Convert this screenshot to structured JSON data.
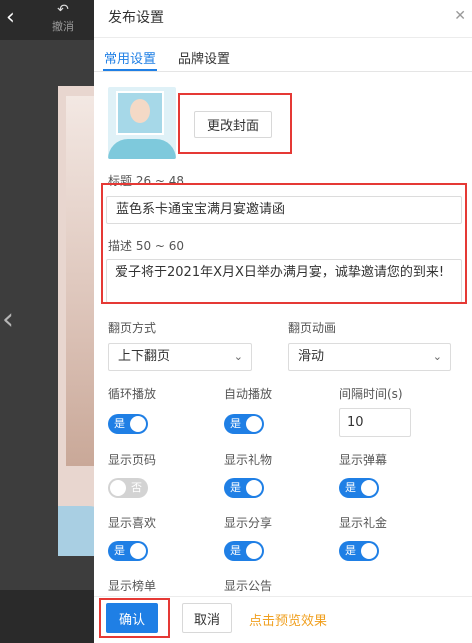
{
  "editor": {
    "undo_label": "撤消"
  },
  "panel": {
    "title": "发布设置",
    "tabs": [
      "常用设置",
      "品牌设置"
    ]
  },
  "cover": {
    "change_label": "更改封面"
  },
  "title_field": {
    "label": "标题 26 ~ 48",
    "value": "蓝色系卡通宝宝满月宴邀请函"
  },
  "desc_field": {
    "label": "描述 50 ~ 60",
    "value": "爱子将于2021年X月X日举办满月宴，诚挚邀请您的到来!"
  },
  "page_turn": {
    "label": "翻页方式",
    "value": "上下翻页"
  },
  "page_anim": {
    "label": "翻页动画",
    "value": "滑动"
  },
  "options": {
    "loop": {
      "label": "循环播放",
      "state": "是"
    },
    "autoplay": {
      "label": "自动播放",
      "state": "是"
    },
    "interval": {
      "label": "间隔时间(s)",
      "value": "10"
    },
    "page_number": {
      "label": "显示页码",
      "state": "否"
    },
    "gift": {
      "label": "显示礼物",
      "state": "是"
    },
    "barrage": {
      "label": "显示弹幕",
      "state": "是"
    },
    "like": {
      "label": "显示喜欢",
      "state": "是"
    },
    "share": {
      "label": "显示分享",
      "state": "是"
    },
    "cash_gift": {
      "label": "显示礼金",
      "state": "是"
    },
    "ranking": {
      "label": "显示榜单"
    },
    "notice": {
      "label": "显示公告"
    }
  },
  "footer": {
    "confirm_label": "确认",
    "cancel_label": "取消",
    "preview_label": "点击预览效果"
  },
  "colors": {
    "accent": "#1f7fe5",
    "highlight_box": "#e53935",
    "preview_link": "#f0a020"
  }
}
